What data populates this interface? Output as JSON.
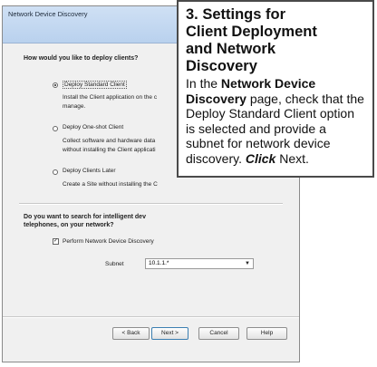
{
  "dialog": {
    "title": "Network Device Discovery",
    "question1": "How would you like to deploy clients?",
    "options": [
      {
        "label": "Deploy Standard Client",
        "selected": true,
        "desc_lines": [
          "Install the Client application on the c",
          "manage."
        ]
      },
      {
        "label": "Deploy One-shot Client",
        "selected": false,
        "desc_lines": [
          "Collect software and hardware data",
          "without installing the Client applicati"
        ]
      },
      {
        "label": "Deploy Clients Later",
        "selected": false,
        "desc_lines": [
          "Create a Site without installing the C"
        ]
      }
    ],
    "question2_lines": [
      "Do you want to search for intelligent dev",
      "telephones, on your network?"
    ],
    "discovery_checkbox": {
      "label": "Perform Network Device Discovery",
      "checked": true
    },
    "subnet": {
      "label": "Subnet",
      "value": "10.1.1.*"
    },
    "buttons": {
      "back": "< Back",
      "next": "Next >",
      "cancel": "Cancel",
      "help": "Help"
    }
  },
  "callout": {
    "heading_lines": [
      "3. Settings for",
      "Client Deployment",
      "and Network",
      "Discovery"
    ],
    "body": {
      "p1": "In the ",
      "b1": "Network Device Discovery",
      "p2": " page, check that the Deploy Standard Client option is selected and provide a subnet for network device discovery. ",
      "i1": "Click",
      "p3": " Next."
    }
  }
}
